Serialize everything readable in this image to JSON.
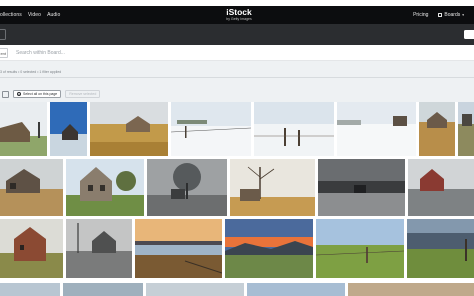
{
  "header": {
    "nav": [
      "ollections",
      "Video",
      "Audio"
    ],
    "logo": "iStock",
    "logo_sub": "by Getty Images",
    "pricing": "Pricing",
    "boards": "Boards"
  },
  "search": {
    "scope_label": "ent",
    "placeholder": "Search within Board..."
  },
  "filters": {
    "summary": "3 of results • 0 selected • 1 filter applied"
  },
  "toolbar": {
    "select_all": "Select all on this page",
    "disabled_action": "Remove selected"
  },
  "grid": {
    "rows": [
      [
        "barn-left-crop",
        "blue-sky-house",
        "golden-field-barn",
        "snow-fence-wide",
        "snow-fence-post",
        "snowy-field-house",
        "autumn-farm",
        "prairie-edge"
      ],
      [
        "weathered-farmhouse",
        "two-story-house",
        "bw-tree-cabin",
        "bare-tree-shack",
        "bw-lonely-barn",
        "bw-house-right"
      ],
      [
        "red-farmhouse",
        "bw-ruin-trees",
        "sunset-lake-sheds",
        "sunset-mountains",
        "green-field-post",
        "storm-fence-field"
      ],
      [
        "bottom-1",
        "bottom-2",
        "bottom-3",
        "bottom-4",
        "bottom-5"
      ]
    ]
  }
}
